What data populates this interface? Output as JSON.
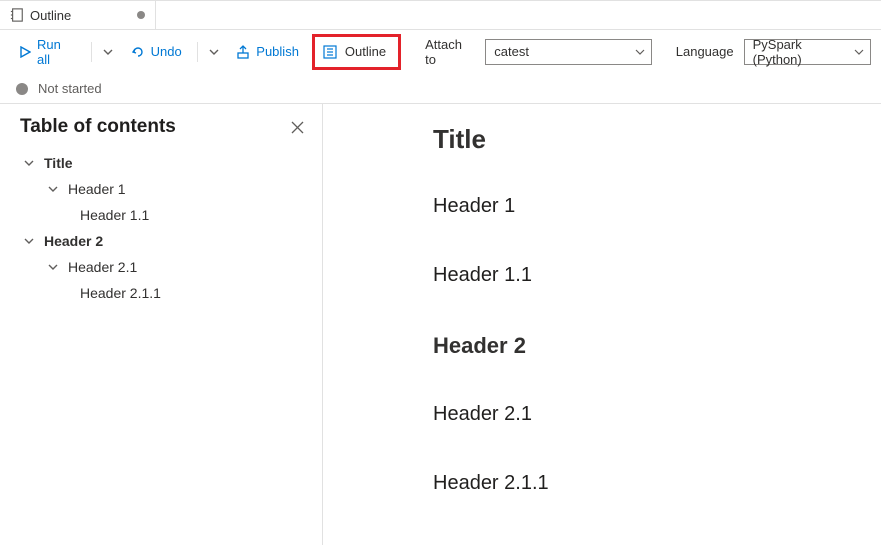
{
  "tab": {
    "label": "Outline"
  },
  "toolbar": {
    "run_all": "Run all",
    "undo": "Undo",
    "publish": "Publish",
    "outline": "Outline",
    "attach_label": "Attach to",
    "attach_value": "catest",
    "language_label": "Language",
    "language_value": "PySpark (Python)"
  },
  "status": {
    "text": "Not started"
  },
  "toc": {
    "title": "Table of contents",
    "items": [
      {
        "label": "Title"
      },
      {
        "label": "Header 1"
      },
      {
        "label": "Header 1.1"
      },
      {
        "label": "Header 2"
      },
      {
        "label": "Header 2.1"
      },
      {
        "label": "Header 2.1.1"
      }
    ]
  },
  "content": {
    "h_title": "Title",
    "h1a": "Header 1",
    "h11": "Header 1.1",
    "h2": "Header 2",
    "h21": "Header 2.1",
    "h211": "Header 2.1.1"
  }
}
